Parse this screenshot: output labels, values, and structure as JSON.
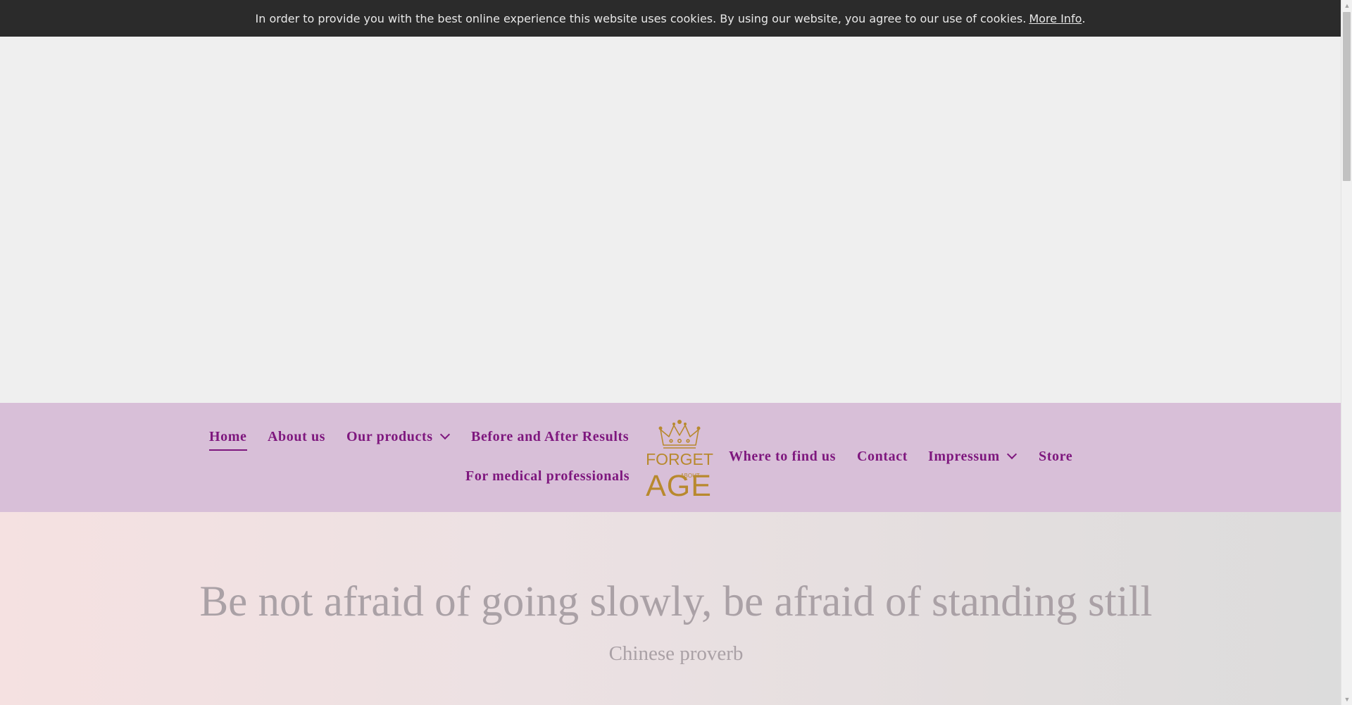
{
  "cookie_bar": {
    "message": "In order to provide you with the best online experience this website uses cookies. By using our website, you agree to our use of cookies.",
    "more_info_label": "More Info",
    "trailing": "."
  },
  "nav": {
    "items": [
      {
        "label": "Home",
        "active": true
      },
      {
        "label": "About us"
      },
      {
        "label": "Our products",
        "has_dropdown": true
      },
      {
        "label": "Before and After Results"
      },
      {
        "label": "For medical professionals"
      },
      {
        "label": "Where to find us"
      },
      {
        "label": "Contact"
      },
      {
        "label": "Impressum",
        "has_dropdown": true
      },
      {
        "label": "Store"
      }
    ]
  },
  "logo": {
    "line1": "FORGET",
    "line2": "ABOUT",
    "line3": "AGE",
    "icon": "crown-icon",
    "color": "#b8892e"
  },
  "quote": {
    "text": "Be not afraid of going slowly, be afraid of standing still",
    "attribution": "Chinese proverb"
  },
  "colors": {
    "nav_background": "#d8bfd8",
    "nav_text": "#7e177e",
    "cookie_background": "#2b2b2b",
    "quote_text": "#aaa1a6"
  }
}
